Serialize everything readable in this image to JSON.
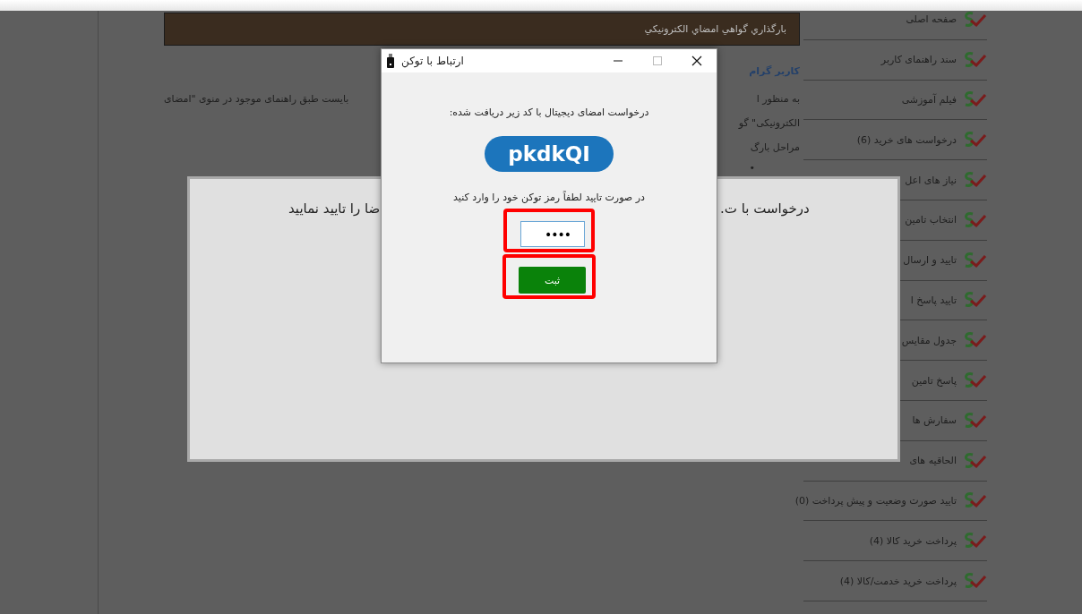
{
  "page": {
    "header_title": "بارگذاري گواهي امضاي الکترونيکي",
    "greeting": "کاربر گرام",
    "paragraph": [
      {
        "right": "به منظور ا",
        "left": "بایست طبق راهنمای موجود در منوی \"امضای"
      },
      {
        "right": "الکترونیکی\" گو"
      },
      {
        "right": "مراحل بارگ"
      }
    ],
    "bullet": "•"
  },
  "sidebar": {
    "items": [
      {
        "label": "صفحه اصلی"
      },
      {
        "label": "سند راهنمای کاربر"
      },
      {
        "label": "فیلم آموزشی"
      },
      {
        "label": "درخواست های خرید (6)"
      },
      {
        "label": "نیاز های اعل"
      },
      {
        "label": "انتخاب تامین"
      },
      {
        "label": "تایید و ارسال"
      },
      {
        "label": "تایید پاسخ ا"
      },
      {
        "label": "جدول مقایس"
      },
      {
        "label": "پاسخ تامین"
      },
      {
        "label": "سفارش ها"
      },
      {
        "label": "الحاقیه های"
      },
      {
        "label": "تایید صورت وضعیت و پیش پرداخت (0)"
      },
      {
        "label": "پرداخت خرید کالا  (4)"
      },
      {
        "label": "پرداخت خرید خدمت/کالا (4)"
      }
    ]
  },
  "notice": {
    "text_right": ".درخواست با ت",
    "text_left": "ضا را تایید نمایید"
  },
  "dialog": {
    "title": "ارتباط با توکن",
    "prompt": "درخواست امضای دیجیتال با کد زیر دریافت شده:",
    "code": "pkdkQI",
    "instruction": "در صورت تایید لطفاً رمز توکن خود را وارد کنید",
    "password_field": {
      "value": "••••",
      "highlighted": true
    },
    "submit_button": {
      "label": "ثبت",
      "highlighted": true
    }
  }
}
